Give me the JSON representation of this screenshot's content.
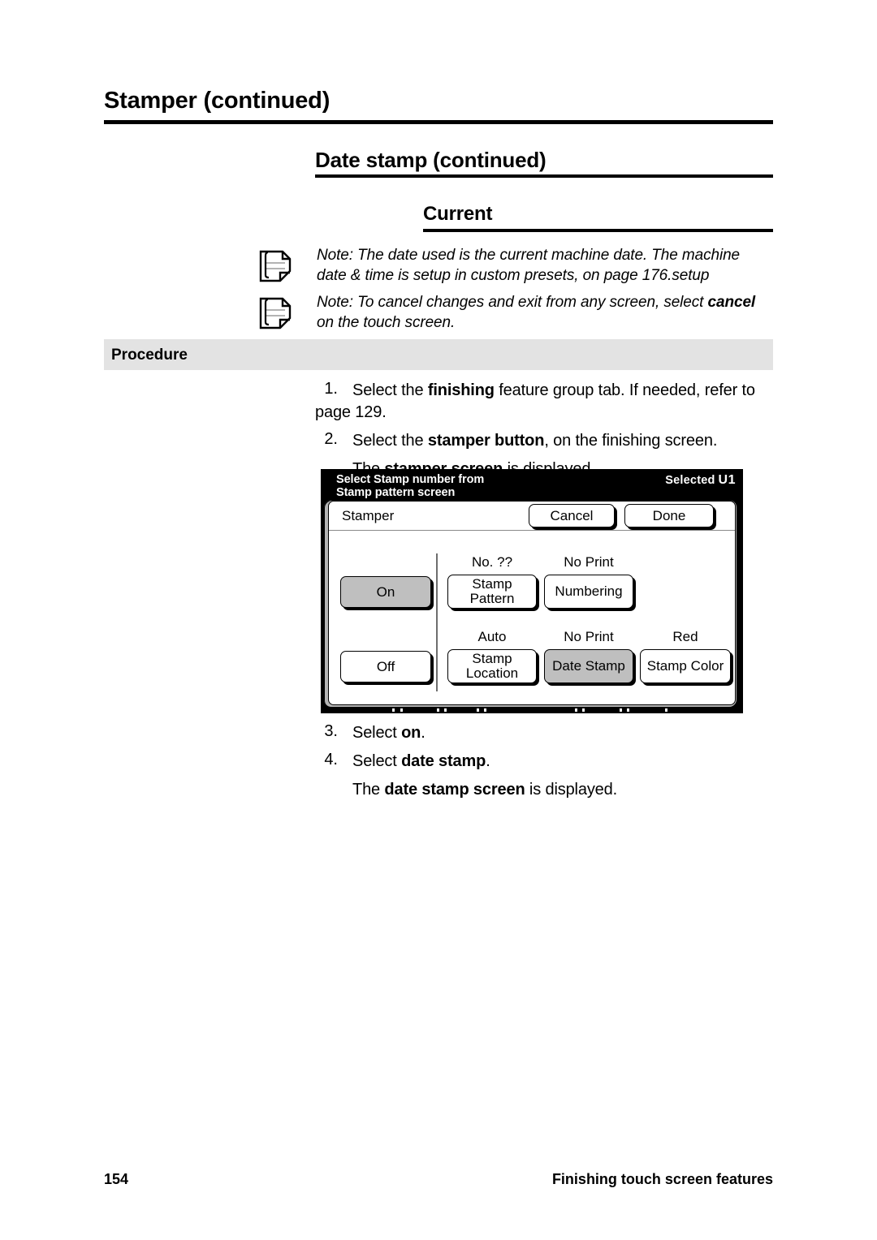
{
  "headings": {
    "page_title": "Stamper (continued)",
    "sub_title": "Date stamp (continued)",
    "sub_sub_title": "Current"
  },
  "notes": [
    {
      "icon": "note-page-icon",
      "prefix": "Note:  ",
      "text": "The date used is the current machine date.  The machine date & time is setup in custom presets, on page 176.setup"
    },
    {
      "icon": "note-page-icon",
      "prefix": "Note:  ",
      "text_part1": "To cancel changes and exit from any screen, select ",
      "bold": "cancel",
      "text_part2": " on the touch screen."
    }
  ],
  "procedure": {
    "label": "Procedure"
  },
  "steps_before_figure": [
    {
      "num": "1.",
      "pre": "Select the ",
      "bold": "finishing",
      "post": " feature group tab.  If needed, refer to page 129."
    },
    {
      "num": "2.",
      "pre": "Select the ",
      "bold": "stamper button",
      "post": ", on the finishing screen."
    }
  ],
  "step2_result": {
    "pre": "The ",
    "bold": "stamper screen",
    "post": " is displayed."
  },
  "steps_after_figure": [
    {
      "num": "3.",
      "pre": "Select ",
      "bold": "on",
      "post": "."
    },
    {
      "num": "4.",
      "pre": "Select ",
      "bold": "date stamp",
      "post": "."
    }
  ],
  "step4_result": {
    "pre": "The ",
    "bold": "date stamp screen",
    "post": " is displayed."
  },
  "touchscreen": {
    "headline_line1": "Select Stamp number from",
    "headline_line2": "Stamp pattern screen",
    "selected_label": "Selected",
    "selected_value": "U1",
    "screen_name": "Stamper",
    "buttons": {
      "cancel": "Cancel",
      "done": "Done",
      "on": "On",
      "off": "Off",
      "stamp_pattern": "Stamp\nPattern",
      "stamp_pattern_l1": "Stamp",
      "stamp_pattern_l2": "Pattern",
      "numbering": "Numbering",
      "stamp_location_l1": "Stamp",
      "stamp_location_l2": "Location",
      "date_stamp": "Date Stamp",
      "stamp_color": "Stamp Color"
    },
    "captions": {
      "stamp_pattern": "No. ??",
      "numbering": "No Print",
      "stamp_location": "Auto",
      "date_stamp": "No Print",
      "stamp_color": "Red"
    },
    "selected_buttons": [
      "on",
      "date_stamp"
    ],
    "colors": {
      "header_band": "#000000",
      "selected_button": "#bfbfbf",
      "bezel": "#b5b5b5"
    }
  },
  "footer": {
    "page_number": "154",
    "section": "Finishing touch screen features"
  }
}
